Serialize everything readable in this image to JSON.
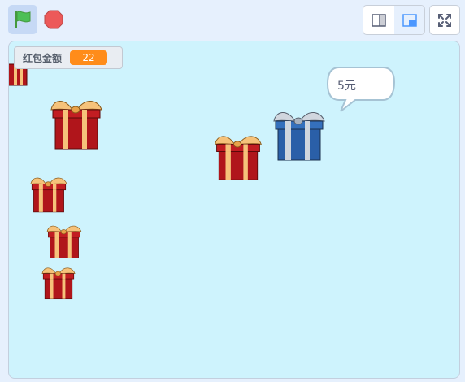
{
  "toolbar": {
    "green_flag": "green-flag-icon",
    "stop": "stop-icon",
    "small_stage": "small-stage-icon",
    "normal_stage": "normal-stage-icon",
    "fullscreen": "fullscreen-icon"
  },
  "stage": {
    "variable_monitor": {
      "label": "红包金额",
      "value": "22"
    },
    "speech_bubble": {
      "text": "5元"
    },
    "sprites": [
      "red-gift",
      "red-gift",
      "red-gift",
      "red-gift",
      "red-gift",
      "red-gift",
      "blue-gift"
    ]
  },
  "colors": {
    "stage_bg": "#cef3fd",
    "monitor_value_bg": "#ff8c1a",
    "gift_red": "#b0151b",
    "gift_blue": "#2a5fa8",
    "ribbon": "#f6c27a",
    "toolbar_bg": "#e6f0fd"
  }
}
